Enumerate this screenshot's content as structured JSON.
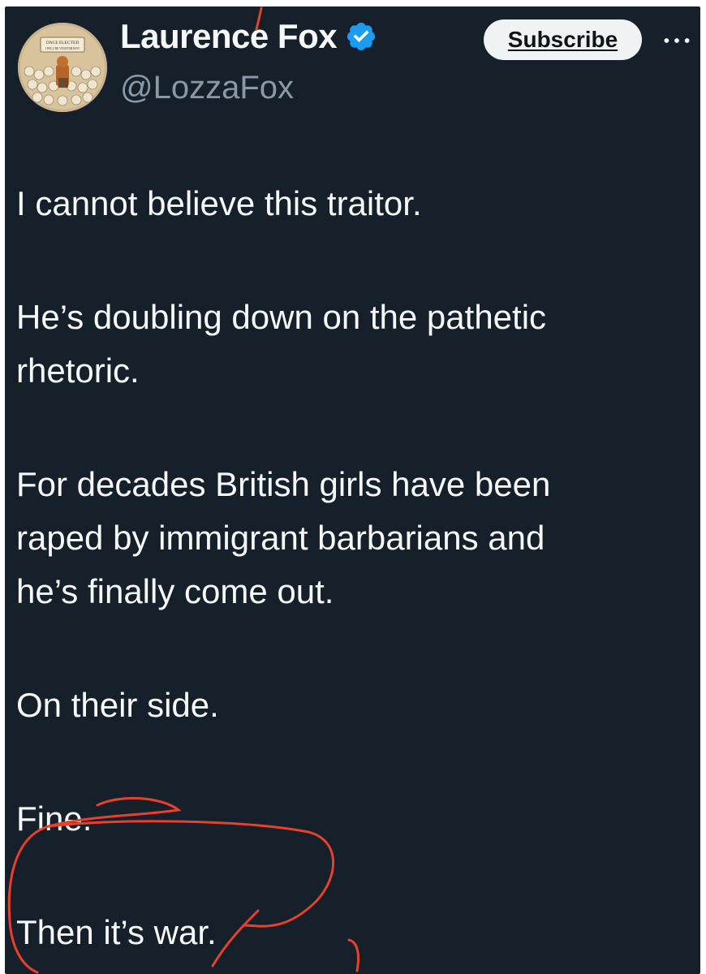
{
  "author": {
    "display_name": "Laurence Fox",
    "handle": "@LozzaFox",
    "verified": true,
    "avatar_sign_lines": [
      "ONCE ELECTED",
      "I WILL BE VEGETARIAN!!"
    ]
  },
  "actions": {
    "subscribe_label": "Subscribe",
    "more_icon": "more-horizontal-icon"
  },
  "tweet": {
    "paragraphs": [
      {
        "lines": [
          "I cannot believe this traitor."
        ]
      },
      {
        "lines": [
          "He’s doubling down on the pathetic",
          "rhetoric."
        ]
      },
      {
        "lines": [
          "For decades British girls have been",
          "raped by immigrant barbarians and",
          "he’s finally come out."
        ]
      },
      {
        "lines": [
          "On their side."
        ]
      },
      {
        "lines": [
          "Fine."
        ]
      },
      {
        "lines": [
          "Then it’s war."
        ]
      }
    ]
  },
  "colors": {
    "background": "#15202b",
    "text_primary": "#f7f9f9",
    "text_secondary": "#8b98a5",
    "verified_badge": "#1d9bf0",
    "annotation_ink": "#e8402a"
  }
}
